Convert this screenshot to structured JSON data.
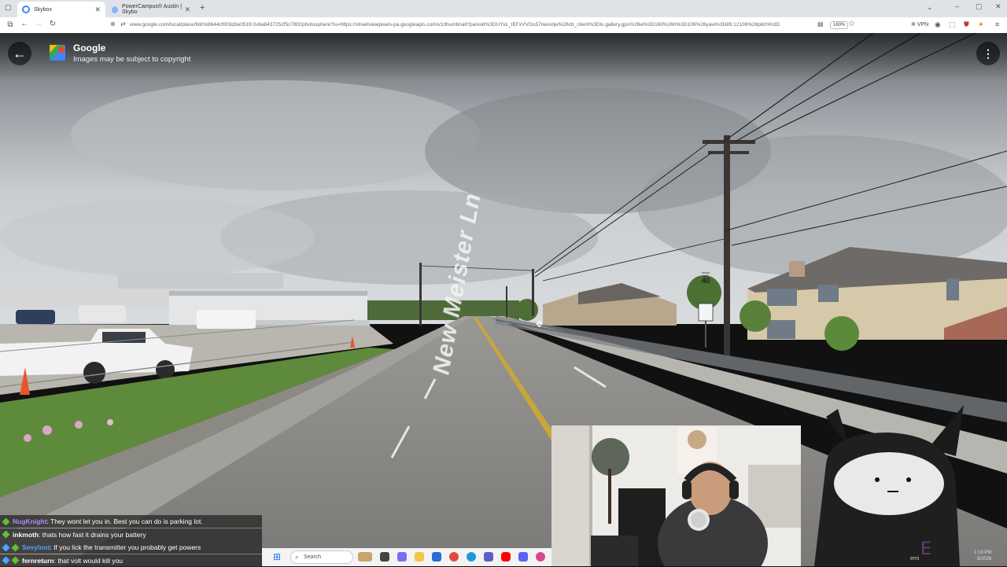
{
  "browser": {
    "tabs": [
      {
        "label": "Skybox",
        "favicon_color": "#4285f4",
        "active": true
      },
      {
        "label": "PowerCampus® Austin | Skybo",
        "favicon_color": "#8ab4f8",
        "active": false
      }
    ],
    "new_tab": "+",
    "url": "www.google.com/local/place/fid/0x8644cf003d3e0519:0x6a8437252f5c78f2/photosphere?iu=https://streetviewpixels-pa.googleapis.com/v1/thumbnail?panoid%3DUYvL_IEFxVVOo57neov/jw%26cb_client%3Dlu.gallery.gps%26w%3D160%26h%3D106%26yaw%3D89.12106%26pitch%3D",
    "zoom": "160%",
    "vpn": "VPN"
  },
  "streetview": {
    "back_label": "←",
    "title": "Google",
    "subtitle": "Images may be subject to copyright",
    "menu_label": "⋮",
    "street_name": "New Meister Ln",
    "speed_sign_top": "SPEED LIMIT",
    "speed_sign_value": "40"
  },
  "chat": [
    {
      "user": "NugKnight",
      "user_color": "#b388ff",
      "message": ": They wont let you in. Best you can do is parking lot."
    },
    {
      "user": "inkmoth",
      "user_color": "#ffffff",
      "message": ": thats how fast it drains your battery"
    },
    {
      "user": "Sevylnot",
      "user_color": "#4fa3ff",
      "message": ": If you lick the transmitter you probably get powers"
    },
    {
      "user": "fernreturn",
      "user_color": "#ffffff",
      "message": ": that volt would kill you"
    }
  ],
  "taskbar": {
    "search_placeholder": "Search"
  },
  "clock": {
    "time": "1:19 PM",
    "date": "8/2026"
  },
  "overlay": {
    "name_tag": "emi"
  }
}
